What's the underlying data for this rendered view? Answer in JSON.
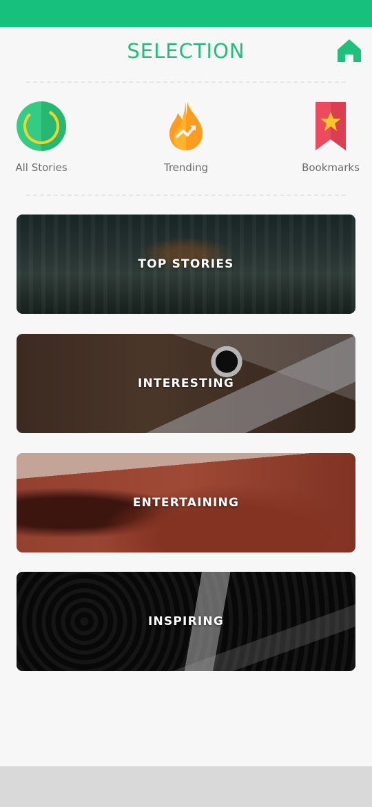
{
  "header": {
    "title": "SELECTION"
  },
  "categories": [
    {
      "label": "All Stories",
      "icon": "all-stories-icon",
      "color": "#2ecc87"
    },
    {
      "label": "Trending",
      "icon": "trending-flame-icon",
      "color": "#ff8a1f"
    },
    {
      "label": "Bookmarks",
      "icon": "bookmark-star-icon",
      "color": "#f04a5d"
    }
  ],
  "cards": [
    {
      "label": "TOP STORIES"
    },
    {
      "label": "INTERESTING"
    },
    {
      "label": "ENTERTAINING"
    },
    {
      "label": "INSPIRING"
    }
  ],
  "colors": {
    "accent": "#18c07e",
    "background": "#f7f7f7"
  }
}
